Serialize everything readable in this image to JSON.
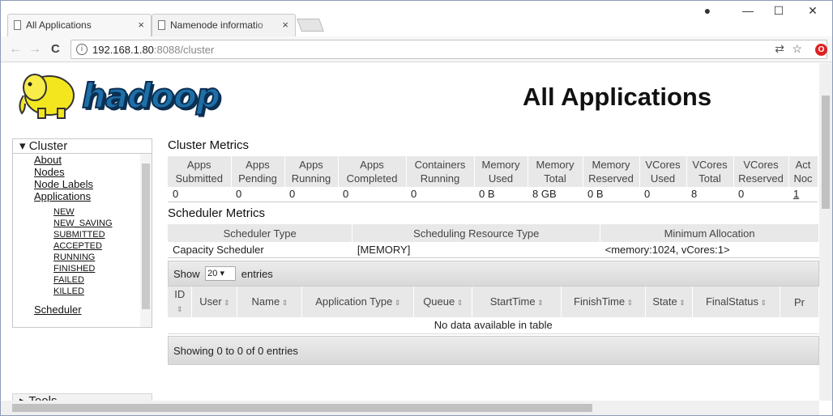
{
  "browser": {
    "tabs": [
      {
        "title": "All Applications",
        "close": "×"
      },
      {
        "title": "Namenode informatio",
        "close": "×"
      }
    ],
    "window_controls": {
      "account": "●",
      "minimize": "—",
      "maximize": "☐",
      "close": "✕"
    },
    "nav": {
      "back": "←",
      "forward": "→",
      "reload": "C"
    },
    "url_host": "192.168.1.80",
    "url_path": ":8088/cluster",
    "omnibox_icons": [
      "translate-icon",
      "star-icon",
      "opera-icon"
    ]
  },
  "header": {
    "logo_text": "hadoop",
    "title": "All Applications"
  },
  "sidebar": {
    "cluster_heading": "▾ Cluster",
    "links": [
      "About",
      "Nodes",
      "Node Labels",
      "Applications"
    ],
    "app_states": [
      "NEW",
      "NEW_SAVING",
      "SUBMITTED",
      "ACCEPTED",
      "RUNNING",
      "FINISHED",
      "FAILED",
      "KILLED"
    ],
    "scheduler": "Scheduler",
    "tools_heading": "▸ Tools"
  },
  "cluster_metrics": {
    "heading": "Cluster Metrics",
    "headers": [
      [
        "Apps",
        "Submitted"
      ],
      [
        "Apps",
        "Pending"
      ],
      [
        "Apps",
        "Running"
      ],
      [
        "Apps",
        "Completed"
      ],
      [
        "Containers",
        "Running"
      ],
      [
        "Memory",
        "Used"
      ],
      [
        "Memory",
        "Total"
      ],
      [
        "Memory",
        "Reserved"
      ],
      [
        "VCores",
        "Used"
      ],
      [
        "VCores",
        "Total"
      ],
      [
        "VCores",
        "Reserved"
      ],
      [
        "Act",
        "Noc"
      ]
    ],
    "values": [
      "0",
      "0",
      "0",
      "0",
      "0",
      "0 B",
      "8 GB",
      "0 B",
      "0",
      "8",
      "0",
      "1"
    ]
  },
  "scheduler_metrics": {
    "heading": "Scheduler Metrics",
    "headers": [
      "Scheduler Type",
      "Scheduling Resource Type",
      "Minimum Allocation"
    ],
    "values": [
      "Capacity Scheduler",
      "[MEMORY]",
      "<memory:1024, vCores:1>"
    ]
  },
  "apps_table": {
    "show_label": "Show",
    "page_size": "20",
    "entries_label": "entries",
    "columns": [
      "ID",
      "User",
      "Name",
      "Application Type",
      "Queue",
      "StartTime",
      "FinishTime",
      "State",
      "FinalStatus",
      "Pr"
    ],
    "empty_message": "No data available in table",
    "footer": "Showing 0 to 0 of 0 entries"
  }
}
